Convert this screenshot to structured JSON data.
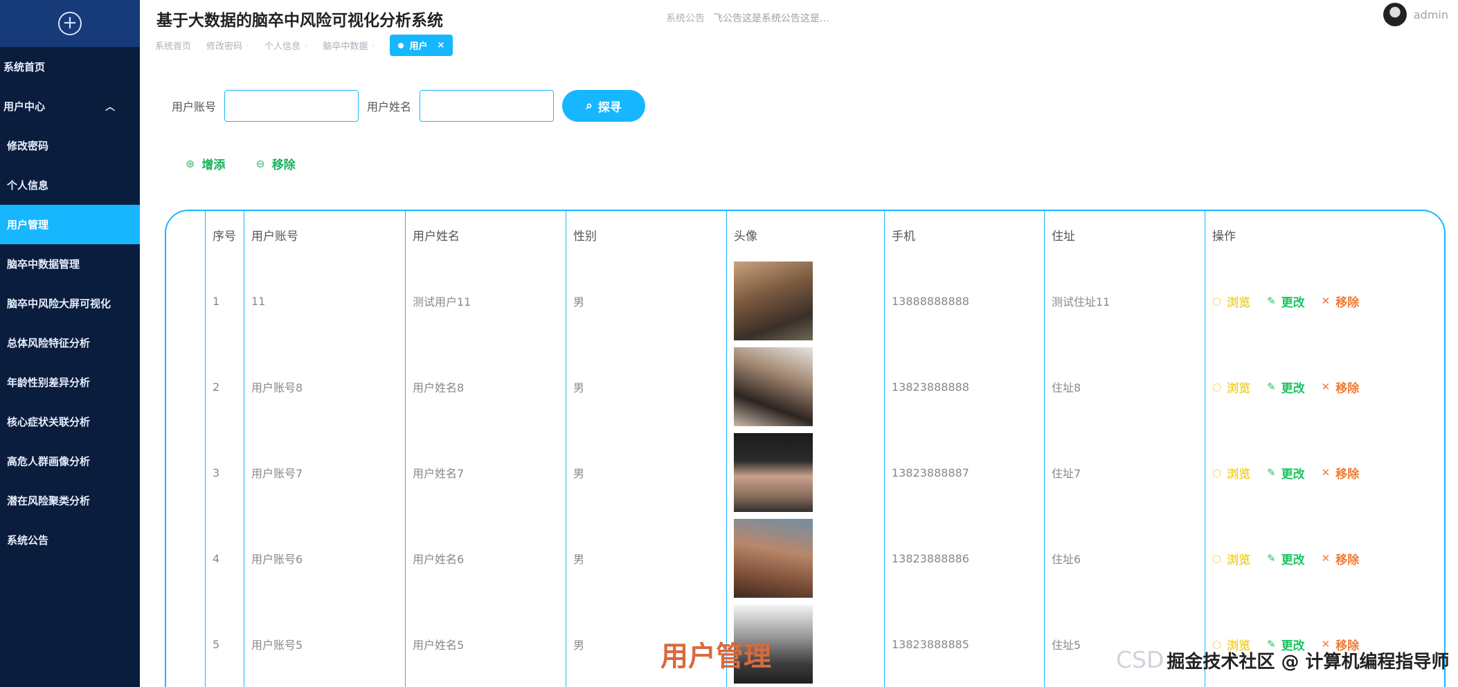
{
  "app": {
    "title": "基于大数据的脑卒中风险可视化分析系统"
  },
  "notice": {
    "label": "系统公告",
    "text": "飞公告这是系统公告这是…"
  },
  "user": {
    "name": "admin"
  },
  "sidebar": {
    "items": [
      {
        "label": "系统首页"
      },
      {
        "label": "用户中心"
      },
      {
        "label": "修改密码"
      },
      {
        "label": "个人信息"
      },
      {
        "label": "用户管理"
      },
      {
        "label": "脑卒中数据管理"
      },
      {
        "label": "脑卒中风险大屏可视化"
      },
      {
        "label": "总体风险特征分析"
      },
      {
        "label": "年龄性别差异分析"
      },
      {
        "label": "核心症状关联分析"
      },
      {
        "label": "高危人群画像分析"
      },
      {
        "label": "潜在风险聚类分析"
      },
      {
        "label": "系统公告"
      }
    ]
  },
  "breadcrumb": {
    "items": [
      "系统首页",
      "修改密码",
      "个人信息",
      "脑卒中数据"
    ],
    "active": "用户"
  },
  "search": {
    "account_label": "用户账号",
    "name_label": "用户姓名",
    "button_label": "探寻"
  },
  "actions": {
    "add": "增添",
    "remove": "移除"
  },
  "table": {
    "headers": [
      "序号",
      "用户账号",
      "用户姓名",
      "性别",
      "头像",
      "手机",
      "住址",
      "操作"
    ],
    "ops": {
      "view": "浏览",
      "edit": "更改",
      "delete": "移除"
    },
    "rows": [
      {
        "seq": "1",
        "account": "11",
        "name": "测试用户11",
        "sex": "男",
        "phone": "13888888888",
        "address": "测试住址11"
      },
      {
        "seq": "2",
        "account": "用户账号8",
        "name": "用户姓名8",
        "sex": "男",
        "phone": "13823888888",
        "address": "住址8"
      },
      {
        "seq": "3",
        "account": "用户账号7",
        "name": "用户姓名7",
        "sex": "男",
        "phone": "13823888887",
        "address": "住址7"
      },
      {
        "seq": "4",
        "account": "用户账号6",
        "name": "用户姓名6",
        "sex": "男",
        "phone": "13823888886",
        "address": "住址6"
      },
      {
        "seq": "5",
        "account": "用户账号5",
        "name": "用户姓名5",
        "sex": "男",
        "phone": "13823888885",
        "address": "住址5"
      }
    ]
  },
  "overlay": {
    "title": "用户管理",
    "credit_prefix": "CSD",
    "credit": "掘金技术社区 @ 计算机编程指导师"
  },
  "colors": {
    "primary": "#16b7ff",
    "sidebar": "#0b1d3d",
    "view": "#f2d43a",
    "edit": "#1cc35f",
    "delete": "#f07b35"
  }
}
